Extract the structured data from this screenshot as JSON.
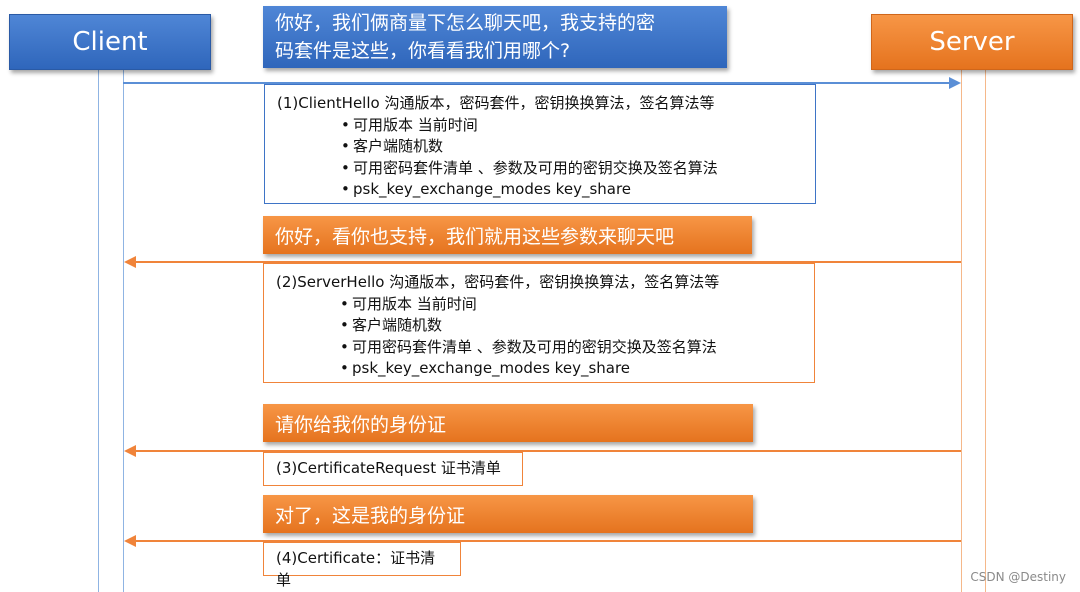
{
  "participants": {
    "client": "Client",
    "server": "Server"
  },
  "messages": [
    {
      "banner": [
        "你好，我们俩商量下怎么聊天吧，我支持的密",
        "码套件是这些，你看看我们用哪个?"
      ],
      "title": "(1)ClientHello 沟通版本，密码套件，密钥换换算法，签名算法等",
      "bullets": [
        "可用版本   当前时间",
        "客户端随机数",
        "可用密码套件清单 、参数及可用的密钥交换及签名算法",
        "psk_key_exchange_modes     key_share"
      ]
    },
    {
      "banner": [
        "你好，看你也支持，我们就用这些参数来聊天吧"
      ],
      "title": "(2)ServerHello 沟通版本，密码套件，密钥换换算法，签名算法等",
      "bullets": [
        "可用版本   当前时间",
        "客户端随机数",
        "可用密码套件清单 、参数及可用的密钥交换及签名算法",
        "psk_key_exchange_modes     key_share"
      ]
    },
    {
      "banner": [
        "请你给我你的身份证"
      ],
      "title": "(3)CertificateRequest  证书清单",
      "bullets": []
    },
    {
      "banner": [
        "对了，这是我的身份证"
      ],
      "title": "(4)Certificate：证书清单",
      "bullets": []
    }
  ],
  "watermark": "CSDN @Destiny",
  "colors": {
    "blue": "#3e74c6",
    "orange": "#f0843a"
  }
}
